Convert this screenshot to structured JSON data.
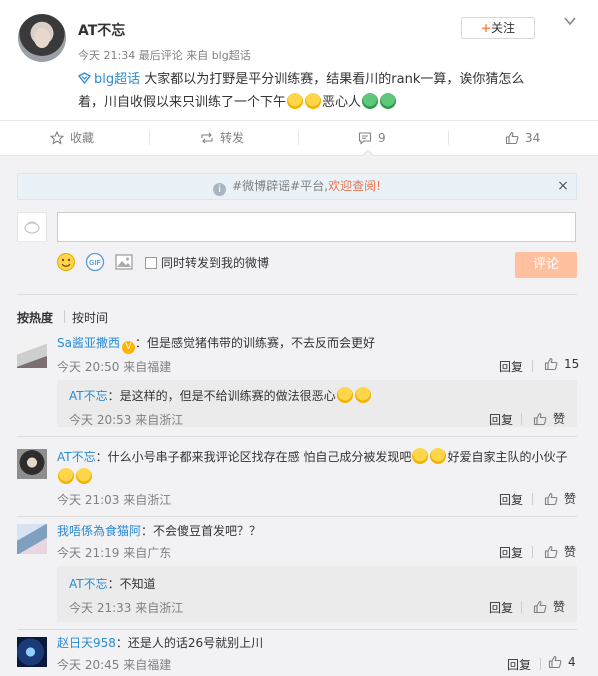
{
  "post": {
    "author": "AT不忘",
    "time": "今天 21:34",
    "meta_edit": "最后评论",
    "meta_from": "来自 blg超话",
    "follow_label": "关注",
    "topic": "blg超话",
    "text_line1": "大家都以为打野是平分训练赛，结果看川的rank一算，诶你猜怎么",
    "text_line2_a": "着，川自收假以来只训练了一个下午",
    "text_line2_b": "恶心人"
  },
  "actions": {
    "favorite": "收藏",
    "repost": "转发",
    "comment_count": "9",
    "like_count": "34"
  },
  "composer": {
    "notice_pre": "#微博辟谣#平台,",
    "notice_link": "欢迎查阅!",
    "notice_close": "×",
    "input_value": "",
    "sync_label": "同时转发到我的微博",
    "submit_label": "评论"
  },
  "sort": {
    "hot": "按热度",
    "time": "按时间"
  },
  "comments": [
    {
      "name": "Sa酱亚撒西",
      "text": "：但是感觉猪伟带的训练赛，不去反而会更好",
      "time": "今天 20:50 来自福建",
      "reply": "回复",
      "likes": "15",
      "replies": [
        {
          "name": "AT不忘",
          "text": "：是这样的，但是不给训练赛的做法很恶心",
          "time": "今天 20:53 来自浙江",
          "reply": "回复",
          "likes": "赞"
        }
      ]
    },
    {
      "name": "AT不忘",
      "text": "：什么小号串子都来我评论区找存在感 怕自己成分被发现吧",
      "text_tail": "好爱自家主队的小伙子",
      "time": "今天 21:03 来自浙江",
      "reply": "回复",
      "likes": "赞"
    },
    {
      "name": "我唔係為食猫阿",
      "text": "：不会傻豆首发吧？？",
      "time": "今天 21:19 来自广东",
      "reply": "回复",
      "likes": "赞",
      "replies": [
        {
          "name": "AT不忘",
          "text": "：不知道",
          "time": "今天 21:33 来自浙江",
          "reply": "回复",
          "likes": "赞"
        }
      ]
    },
    {
      "name": "赵日天958",
      "text": "：还是人的话26号就别上川",
      "time": "今天 20:45 来自福建",
      "reply": "回复",
      "likes": "4"
    }
  ]
}
